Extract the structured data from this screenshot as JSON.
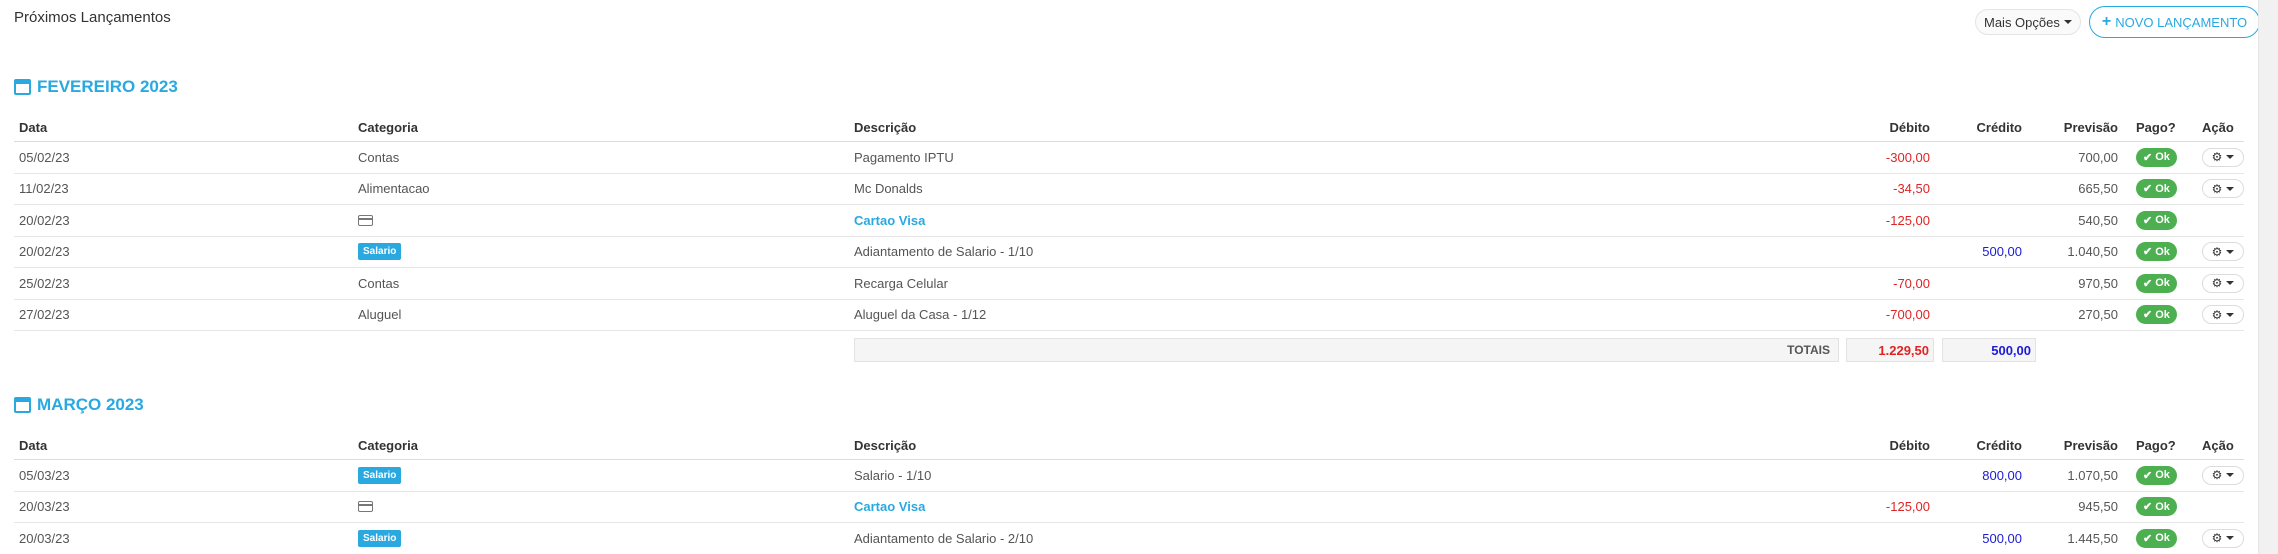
{
  "header": {
    "title": "Próximos Lançamentos",
    "more_options": "Mais Opções",
    "new_entry": "NOVO LANÇAMENTO"
  },
  "columns": {
    "date": "Data",
    "category": "Categoria",
    "description": "Descrição",
    "debit": "Débito",
    "credit": "Crédito",
    "forecast": "Previsão",
    "paid": "Pago?",
    "action": "Ação"
  },
  "ok_label": "Ok",
  "icons": {
    "calendar": "calendar-icon",
    "card": "credit-card-icon",
    "check": "check-icon",
    "cogs": "cogs-icon",
    "plus": "plus-icon",
    "caret": "caret-down-icon"
  },
  "colors": {
    "accent": "#29a9e0",
    "debit": "#e02424",
    "credit": "#1b1bd6",
    "ok": "#4caf50"
  },
  "months": [
    {
      "title": "FEVEREIRO 2023",
      "rows": [
        {
          "date": "05/02/23",
          "category": "Contas",
          "category_type": "text",
          "description": "Pagamento IPTU",
          "description_link": false,
          "debit": "-300,00",
          "credit": "",
          "forecast": "700,00",
          "has_action": true
        },
        {
          "date": "11/02/23",
          "category": "Alimentacao",
          "category_type": "text",
          "description": "Mc Donalds",
          "description_link": false,
          "debit": "-34,50",
          "credit": "",
          "forecast": "665,50",
          "has_action": true
        },
        {
          "date": "20/02/23",
          "category": "",
          "category_type": "card",
          "description": "Cartao Visa",
          "description_link": true,
          "debit": "-125,00",
          "credit": "",
          "forecast": "540,50",
          "has_action": false
        },
        {
          "date": "20/02/23",
          "category": "Salario",
          "category_type": "badge",
          "description": "Adiantamento de Salario - 1/10",
          "description_link": false,
          "debit": "",
          "credit": "500,00",
          "forecast": "1.040,50",
          "has_action": true
        },
        {
          "date": "25/02/23",
          "category": "Contas",
          "category_type": "text",
          "description": "Recarga Celular",
          "description_link": false,
          "debit": "-70,00",
          "credit": "",
          "forecast": "970,50",
          "has_action": true
        },
        {
          "date": "27/02/23",
          "category": "Aluguel",
          "category_type": "text",
          "description": "Aluguel da Casa - 1/12",
          "description_link": false,
          "debit": "-700,00",
          "credit": "",
          "forecast": "270,50",
          "has_action": true
        }
      ],
      "totals": {
        "label": "TOTAIS",
        "debit": "1.229,50",
        "credit": "500,00"
      }
    },
    {
      "title": "MARÇO 2023",
      "rows": [
        {
          "date": "05/03/23",
          "category": "Salario",
          "category_type": "badge",
          "description": "Salario - 1/10",
          "description_link": false,
          "debit": "",
          "credit": "800,00",
          "forecast": "1.070,50",
          "has_action": true
        },
        {
          "date": "20/03/23",
          "category": "",
          "category_type": "card",
          "description": "Cartao Visa",
          "description_link": true,
          "debit": "-125,00",
          "credit": "",
          "forecast": "945,50",
          "has_action": false
        },
        {
          "date": "20/03/23",
          "category": "Salario",
          "category_type": "badge",
          "description": "Adiantamento de Salario - 2/10",
          "description_link": false,
          "debit": "",
          "credit": "500,00",
          "forecast": "1.445,50",
          "has_action": true
        }
      ]
    }
  ]
}
